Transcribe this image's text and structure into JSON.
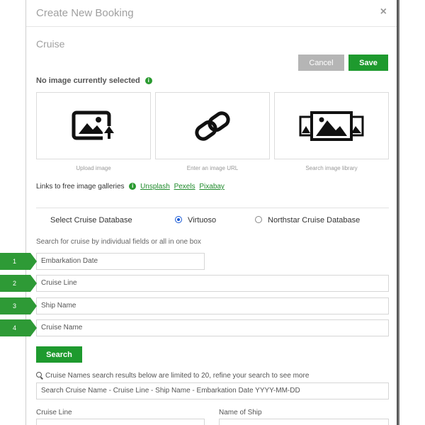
{
  "modal": {
    "title": "Create New Booking",
    "close_label": "×",
    "section_title": "Cruise",
    "cancel_label": "Cancel",
    "save_label": "Save"
  },
  "image": {
    "no_image_label": "No image currently selected",
    "info_label": "i",
    "options": [
      {
        "caption": "Upload image",
        "icon": "upload-image-icon"
      },
      {
        "caption": "Enter an image URL",
        "icon": "link-icon"
      },
      {
        "caption": "Search image library",
        "icon": "image-gallery-icon"
      }
    ],
    "galleries_label": "Links to free image galleries",
    "gallery_links": [
      "Unsplash",
      "Pexels",
      "Pixabay"
    ]
  },
  "database": {
    "label": "Select Cruise Database",
    "options": [
      {
        "label": "Virtuoso",
        "checked": true
      },
      {
        "label": "Northstar Cruise Database",
        "checked": false
      }
    ]
  },
  "search": {
    "hint": "Search for cruise by individual fields or all in one box",
    "fields": [
      {
        "step": "1",
        "placeholder": "Embarkation Date"
      },
      {
        "step": "2",
        "placeholder": "Cruise Line"
      },
      {
        "step": "3",
        "placeholder": "Ship Name"
      },
      {
        "step": "4",
        "placeholder": "Cruise Name"
      }
    ],
    "button_label": "Search",
    "limit_note": "Cruise Names search results below are limited to 20, refine your search to see more",
    "combined_placeholder": "Search Cruise Name - Cruise Line - Ship Name - Embarkation Date YYYY-MM-DD"
  },
  "results": {
    "cruise_line_label": "Cruise Line",
    "ship_label": "Name of Ship"
  },
  "colors": {
    "accent": "#1e9a2e",
    "step_green": "#2e9a36",
    "cancel_gray": "#b5b5b5"
  }
}
